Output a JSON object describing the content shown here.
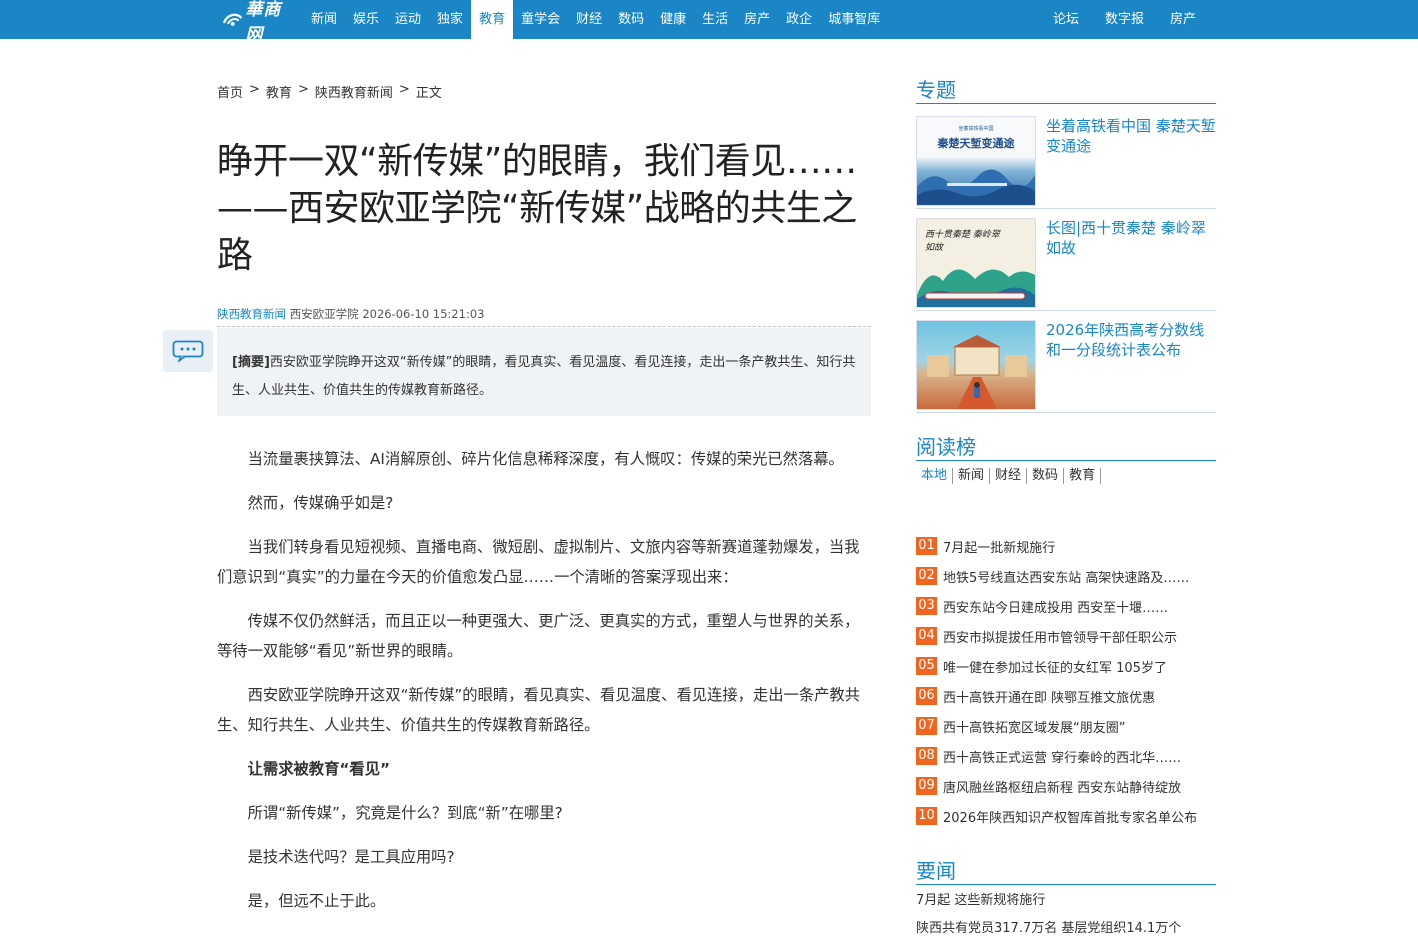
{
  "nav": {
    "logo_text": "華商网",
    "items": [
      "新闻",
      "娱乐",
      "运动",
      "独家",
      "教育",
      "童学会",
      "财经",
      "数码",
      "健康",
      "生活",
      "房产",
      "政企",
      "城事智库"
    ],
    "active_index": 4,
    "right_items": [
      "论坛",
      "数字报",
      "房产"
    ]
  },
  "breadcrumb": [
    "首页",
    "教育",
    "陕西教育新闻",
    "正文"
  ],
  "breadcrumb_sep": ">",
  "article": {
    "title": "睁开一双“新传媒”的眼睛，我们看见……——西安欧亚学院“新传媒”战略的共生之路",
    "source": "陕西教育新闻",
    "author": "西安欧亚学院",
    "datetime": "2026-06-10 15:21:03",
    "summary_label": "[摘要]",
    "summary_text": "西安欧亚学院睁开这双“新传媒”的眼睛，看见真实、看见温度、看见连接，走出一条产教共生、知行共生、人业共生、价值共生的传媒教育新路径。",
    "paragraphs": [
      "当流量裹挟算法、AI消解原创、碎片化信息稀释深度，有人慨叹：传媒的荣光已然落幕。",
      "然而，传媒确乎如是?",
      "当我们转身看见短视频、直播电商、微短剧、虚拟制片、文旅内容等新赛道蓬勃爆发，当我们意识到“真实”的力量在今天的价值愈发凸显……一个清晰的答案浮现出来：",
      "传媒不仅仍然鲜活，而且正以一种更强大、更广泛、更真实的方式，重塑人与世界的关系，等待一双能够“看见”新世界的眼睛。",
      "西安欧亚学院睁开这双“新传媒”的眼睛，看见真实、看见温度、看见连接，走出一条产教共生、知行共生、人业共生、价值共生的传媒教育新路径。",
      "让需求被教育“看见”",
      "所谓“新传媒”，究竟是什么？到底“新”在哪里?",
      "是技术迭代吗？是工具应用吗?",
      "是，但远不止于此。"
    ]
  },
  "sidebar": {
    "topics_title": "专题",
    "topics": [
      {
        "title": "坐着高铁看中国 秦楚天堑变通途",
        "image_text": "秦楚天堑变通途",
        "image_caption": "坐着高铁看中国"
      },
      {
        "title": "长图|西十贯秦楚 秦岭翠如故",
        "image_text": "西十贯秦楚 秦岭翠如故"
      },
      {
        "title": "2026年陕西高考分数线和一分段统计表公布"
      }
    ],
    "ranking_title": "阅读榜",
    "ranking_tabs": [
      "本地",
      "新闻",
      "财经",
      "数码",
      "教育"
    ],
    "ranking_active": 0,
    "ranking": [
      {
        "num": "01",
        "text": "7月起一批新规施行"
      },
      {
        "num": "02",
        "text": "地铁5号线直达西安东站 高架快速路及……"
      },
      {
        "num": "03",
        "text": "西安东站今日建成投用 西安至十堰……"
      },
      {
        "num": "04",
        "text": "西安市拟提拔任用市管领导干部任职公示"
      },
      {
        "num": "05",
        "text": "唯一健在参加过长征的女红军 105岁了"
      },
      {
        "num": "06",
        "text": "西十高铁开通在即 陕鄂互推文旅优惠"
      },
      {
        "num": "07",
        "text": "西十高铁拓宽区域发展“朋友圈”"
      },
      {
        "num": "08",
        "text": "西十高铁正式运营 穿行秦岭的西北华……"
      },
      {
        "num": "09",
        "text": "唐风融丝路枢纽启新程 西安东站静待绽放"
      },
      {
        "num": "10",
        "text": "2026年陕西知识产权智库首批专家名单公布"
      }
    ],
    "news_title": "要闻",
    "news": [
      "7月起 这些新规将施行",
      "陕西共有党员317.7万名 基层党组织14.1万个"
    ]
  },
  "colors": {
    "brand": "#1a86c6",
    "rank_badge": "#f06620"
  }
}
